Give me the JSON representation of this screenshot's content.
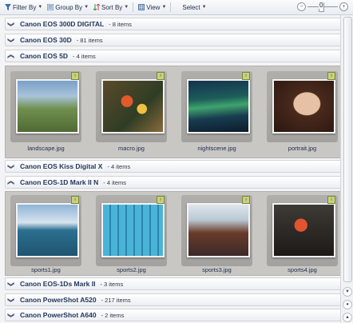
{
  "toolbar": {
    "filter_label": "Filter By",
    "group_label": "Group By",
    "sort_label": "Sort By",
    "view_label": "View",
    "select_label": "Select",
    "zoom_minus": "−",
    "zoom_value": "0",
    "zoom_plus": "+"
  },
  "groups": [
    {
      "name": "Canon EOS 300D DIGITAL",
      "count": "- 8 items",
      "state": "collapsed"
    },
    {
      "name": "Canon EOS 30D",
      "count": "- 81 items",
      "state": "collapsed"
    },
    {
      "name": "Canon EOS 5D",
      "count": "- 4 items",
      "state": "expanded"
    },
    {
      "name": "Canon EOS Kiss Digital X",
      "count": "- 4 items",
      "state": "collapsed"
    },
    {
      "name": "Canon EOS-1D Mark II N",
      "count": "- 4 items",
      "state": "expanded"
    },
    {
      "name": "Canon EOS-1Ds Mark II",
      "count": "- 3 items",
      "state": "collapsed"
    },
    {
      "name": "Canon PowerShot A520",
      "count": "- 217 items",
      "state": "collapsed"
    },
    {
      "name": "Canon PowerShot A640",
      "count": "- 2 items",
      "state": "collapsed"
    }
  ],
  "chevrons": {
    "collapsed": "❯",
    "expanded": "❮"
  },
  "eos5d_photos": [
    {
      "file": "landscape.jpg",
      "badge": "i"
    },
    {
      "file": "macro.jpg",
      "badge": "i"
    },
    {
      "file": "nightscene.jpg",
      "badge": "i"
    },
    {
      "file": "portrait.jpg",
      "badge": "i"
    }
  ],
  "eos1d_photos": [
    {
      "file": "sports1.jpg",
      "badge": "i"
    },
    {
      "file": "sports2.jpg",
      "badge": "i"
    },
    {
      "file": "sports3.jpg",
      "badge": "i"
    },
    {
      "file": "sports4.jpg",
      "badge": "i"
    }
  ],
  "icons": {
    "filter": "funnel-icon",
    "group": "group-icon",
    "sort": "sort-icon",
    "view": "view-icon",
    "badge": "rating-badge-icon"
  },
  "colors": {
    "accent": "#23375e",
    "panel": "#c9c7c4",
    "toolbar": "#e9ecf1"
  },
  "scroll": {
    "up": "▲",
    "down": "▼",
    "mid": "●"
  }
}
